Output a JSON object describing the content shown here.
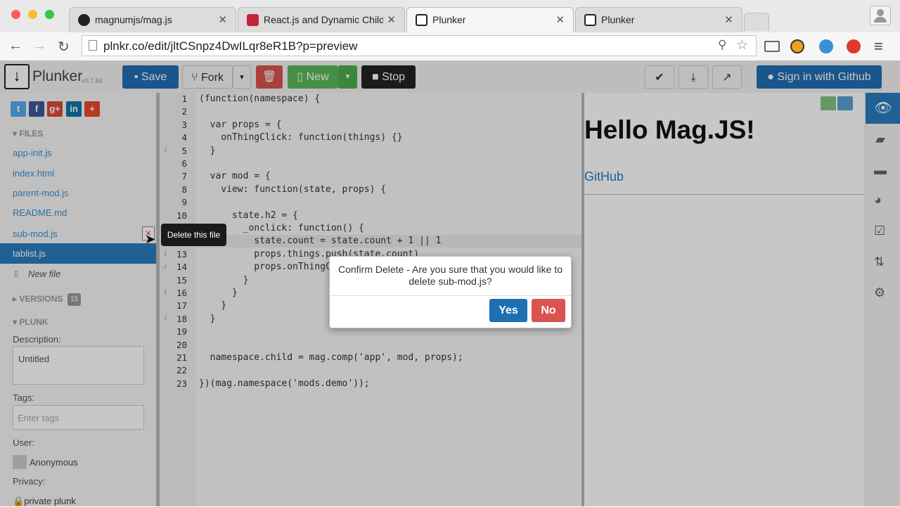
{
  "browser": {
    "tabs": [
      {
        "title": "magnumjs/mag.js",
        "icon": "github-icon"
      },
      {
        "title": "React.js and Dynamic Children",
        "icon": "angular-icon"
      },
      {
        "title": "Plunker",
        "icon": "plunker-icon"
      },
      {
        "title": "Plunker",
        "icon": "plunker-icon"
      }
    ],
    "url": "plnkr.co/edit/jltCSnpz4DwILqr8eR1B?p=preview"
  },
  "toolbar": {
    "brand": "Plunker",
    "version": "v0.7.84",
    "save": "Save",
    "fork": "Fork",
    "new": "New",
    "stop": "Stop",
    "signin": "Sign in with Github"
  },
  "sidebar": {
    "files_header": "FILES",
    "files": [
      "app-init.js",
      "index.html",
      "parent-mod.js",
      "README.md",
      "sub-mod.js",
      "tablist.js"
    ],
    "active_file": "tablist.js",
    "new_file": "New file",
    "versions_header": "VERSIONS",
    "versions_count": "15",
    "plunk_header": "PLUNK",
    "description_label": "Description:",
    "description_value": "Untitled",
    "tags_label": "Tags:",
    "tags_placeholder": "Enter tags",
    "user_label": "User:",
    "user_name": "Anonymous",
    "privacy_label": "Privacy:",
    "privacy_value": "private plunk"
  },
  "tooltip": "Delete this file",
  "dialog": {
    "message": "Confirm Delete - Are you sure that you would like to delete sub-mod.js?",
    "yes": "Yes",
    "no": "No"
  },
  "preview": {
    "heading": "Hello Mag.JS!",
    "link": "GitHub"
  },
  "code_lines": [
    "(function(namespace) {",
    "",
    "  var props = {",
    "    onThingClick: function(things) {}",
    "  }",
    "",
    "  var mod = {",
    "    view: function(state, props) {",
    "",
    "      state.h2 = {",
    "        _onclick: function() {",
    "          state.count = state.count + 1 || 1",
    "          props.things.push(state.count)",
    "          props.onThingClick(props.things)",
    "        }",
    "      }",
    "    }",
    "  }",
    "",
    "",
    "  namespace.child = mag.comp('app', mod, props);",
    "",
    "})(mag.namespace('mods.demo'));"
  ],
  "colors": {
    "primary": "#1f6fb3",
    "success": "#5cb85c",
    "danger": "#d9534f",
    "dark": "#222222",
    "active_file_bg": "#2a7bbf"
  }
}
